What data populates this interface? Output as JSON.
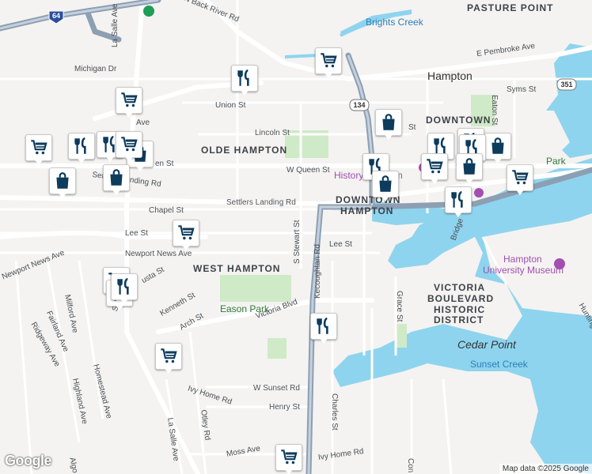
{
  "labels": {
    "pasture_point": "PASTURE POINT",
    "hampton": "Hampton",
    "downtown": "DOWNTOWN",
    "olde_hampton": "OLDE HAMPTON",
    "downtown_hampton_1": "DOWNTOWN",
    "downtown_hampton_2": "HAMPTON",
    "west_hampton": "WEST HAMPTON",
    "victoria_1": "VICTORIA",
    "victoria_2": "BOULEVARD",
    "victoria_3": "HISTORIC",
    "victoria_4": "DISTRICT",
    "cedar_point": "Cedar Point",
    "sunset_creek": "Sunset Creek",
    "brights_creek": "Brights Creek",
    "eason_park": "Eason Park",
    "history_museum": "History Museum",
    "univ_museum_1": "Hampton",
    "univ_museum_2": "University Museum",
    "wt_park": "Park"
  },
  "streets": {
    "back_river": "N Back River Rd",
    "la_salle_top": "La Salle Ave",
    "michigan": "Michigan Dr",
    "e_pembroke": "E Pembroke Ave",
    "syms": "Syms St",
    "eaton": "Eaton St",
    "union": "Union St",
    "lincoln": "Lincoln St",
    "queen_w": "W Queen St",
    "queen_left": "en St",
    "settlers": "Settlers Landing Rd",
    "settlers_left": "Settlers Landing Rd",
    "chapel": "Chapel St",
    "lee_left": "Lee St",
    "lee_right": "Lee St",
    "stewart": "S Stewart St",
    "kecoughtan": "Kecoughtan Rd",
    "newport_mid": "Newport News Ave",
    "newport_left": "Newport News Ave",
    "augusta": "usta St",
    "kenneth": "Kenneth St",
    "arch": "Arch St",
    "victoria_blvd": "Victoria Blvd",
    "milford": "Milford Ave",
    "fairland": "Fairland Ave",
    "ridgeway": "Ridgeway Ave",
    "shell": "Shell Rd",
    "homestead": "Homestead Ave",
    "highland": "Highland Ave",
    "ivy_home_left": "Ivy Home Rd",
    "ivy_home_bottom": "Ivy Home Rd",
    "otley": "Otley Rd",
    "la_salle_bottom": "La Salle Ave",
    "w_sunset": "W Sunset Rd",
    "henry": "Henry St",
    "charles": "Charles St",
    "moss": "Moss Ave",
    "grace": "Grace St",
    "bridge": "Bridge",
    "hunting": "Huntingt",
    "ave_left": "Ave",
    "rd_left": "rd",
    "algo": "Algo",
    "ave_right": "Ave",
    "lincoln_st": "St",
    "ave_mid": "Ave",
    "con": "Con"
  },
  "shields": {
    "i64": "64",
    "r134": "134",
    "r351": "351"
  },
  "markers": [
    {
      "icon": "shopping-cart-icon"
    },
    {
      "icon": "restaurant-icon"
    },
    {
      "icon": "shopping-cart-icon"
    },
    {
      "icon": "shopping-bag-icon"
    },
    {
      "icon": "restaurant-icon"
    },
    {
      "icon": "restaurant-icon"
    },
    {
      "icon": "shopping-cart-icon"
    },
    {
      "icon": "shopping-bag-icon"
    },
    {
      "icon": "shopping-cart-icon"
    },
    {
      "icon": "shopping-bag-icon"
    },
    {
      "icon": "shopping-bag-icon"
    },
    {
      "icon": "restaurant-icon"
    },
    {
      "icon": "restaurant-icon"
    },
    {
      "icon": "shopping-cart-icon"
    },
    {
      "icon": "restaurant-icon"
    },
    {
      "icon": "shopping-bag-icon"
    },
    {
      "icon": "restaurant-icon"
    },
    {
      "icon": "shopping-bag-icon"
    },
    {
      "icon": "shopping-cart-icon"
    },
    {
      "icon": "shopping-bag-icon"
    },
    {
      "icon": "shopping-cart-icon"
    },
    {
      "icon": "restaurant-icon"
    },
    {
      "icon": "shopping-cart-icon"
    },
    {
      "icon": "restaurant-icon"
    },
    {
      "icon": "shopping-cart-icon"
    },
    {
      "icon": "restaurant-icon"
    },
    {
      "icon": "restaurant-icon"
    },
    {
      "icon": "shopping-cart-icon"
    }
  ],
  "logo": "Google",
  "credit": "Map data ©2025 Google",
  "colors": {
    "water": "#8fd4ee",
    "park": "#cfeac7",
    "marker": "#0d3b5c",
    "highway": "#8c9fb3"
  }
}
